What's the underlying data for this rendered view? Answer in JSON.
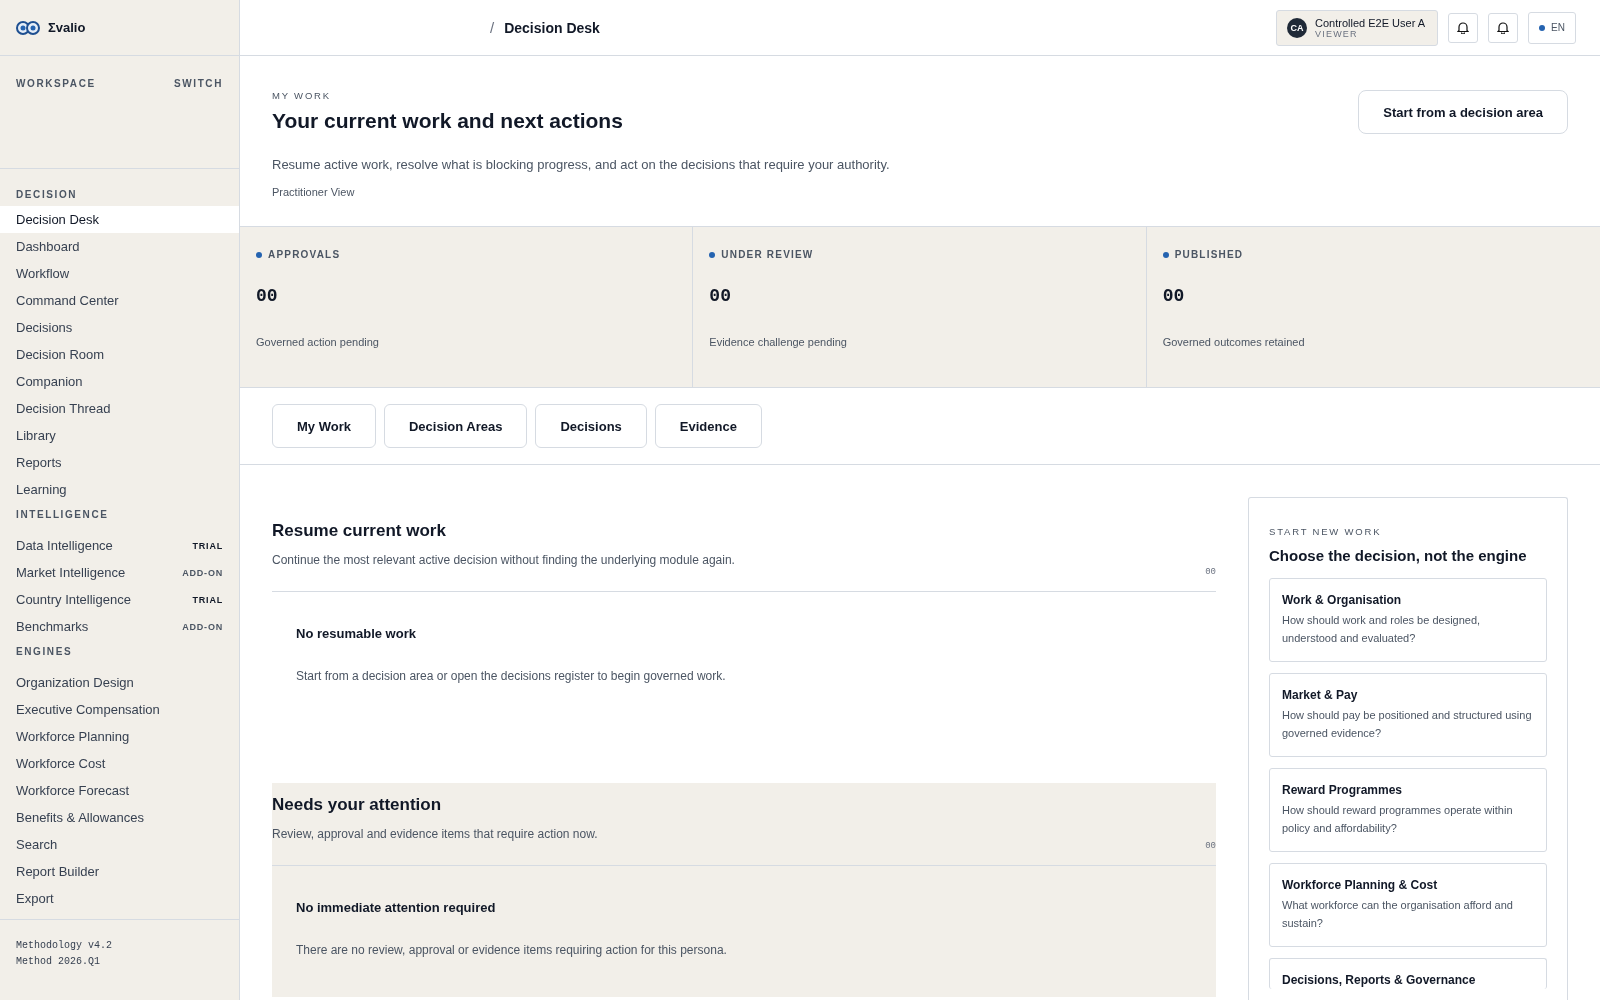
{
  "brand": {
    "name": "Σvalio"
  },
  "breadcrumb": {
    "separator": "/",
    "current": "Decision Desk"
  },
  "user": {
    "initials": "CA",
    "name": "Controlled E2E User A",
    "role": "VIEWER"
  },
  "language": {
    "code": "EN"
  },
  "sidebar": {
    "workspace_label": "WORKSPACE",
    "switch_label": "SWITCH",
    "sections": [
      {
        "title": "DECISION",
        "items": [
          {
            "label": "Decision Desk",
            "selected": true
          },
          {
            "label": "Dashboard",
            "selected": false
          },
          {
            "label": "Workflow",
            "selected": false
          },
          {
            "label": "Command Center",
            "selected": false
          },
          {
            "label": "Decisions",
            "selected": false
          },
          {
            "label": "Decision Room",
            "selected": false
          },
          {
            "label": "Companion",
            "selected": false
          },
          {
            "label": "Decision Thread",
            "selected": false
          },
          {
            "label": "Library",
            "selected": false
          },
          {
            "label": "Reports",
            "selected": false
          },
          {
            "label": "Learning",
            "selected": false
          }
        ]
      },
      {
        "title": "INTELLIGENCE",
        "items": [
          {
            "label": "Data Intelligence",
            "selected": false,
            "badge": {
              "text": "TRIAL",
              "kind": "trial"
            }
          },
          {
            "label": "Market Intelligence",
            "selected": false,
            "badge": {
              "text": "ADD-ON",
              "kind": "addon"
            }
          },
          {
            "label": "Country Intelligence",
            "selected": false,
            "badge": {
              "text": "TRIAL",
              "kind": "trial"
            }
          },
          {
            "label": "Benchmarks",
            "selected": false,
            "badge": {
              "text": "ADD-ON",
              "kind": "addon"
            }
          }
        ]
      },
      {
        "title": "ENGINES",
        "items": [
          {
            "label": "Organization Design",
            "selected": false
          },
          {
            "label": "Executive Compensation",
            "selected": false
          },
          {
            "label": "Workforce Planning",
            "selected": false
          },
          {
            "label": "Workforce Cost",
            "selected": false
          },
          {
            "label": "Workforce Forecast",
            "selected": false
          },
          {
            "label": "Benefits & Allowances",
            "selected": false
          },
          {
            "label": "Search",
            "selected": false
          },
          {
            "label": "Report Builder",
            "selected": false
          },
          {
            "label": "Export",
            "selected": false
          }
        ]
      }
    ],
    "footer": [
      "Methodology v4.2",
      "Method 2026.Q1"
    ]
  },
  "header": {
    "eyebrow": "MY WORK",
    "title": "Your current work and next actions",
    "description": "Resume active work, resolve what is blocking progress, and act on the decisions that require your authority.",
    "view": "Practitioner View",
    "action": "Start from a decision area"
  },
  "stats": [
    {
      "label": "APPROVALS",
      "value": "00",
      "caption": "Governed action pending"
    },
    {
      "label": "UNDER REVIEW",
      "value": "00",
      "caption": "Evidence challenge pending"
    },
    {
      "label": "PUBLISHED",
      "value": "00",
      "caption": "Governed outcomes retained"
    }
  ],
  "tabs": [
    {
      "label": "My Work",
      "selected": false
    },
    {
      "label": "Decision Areas",
      "selected": false
    },
    {
      "label": "Decisions",
      "selected": false
    },
    {
      "label": "Evidence",
      "selected": false
    }
  ],
  "sections": [
    {
      "title": "Resume current work",
      "description": "Continue the most relevant active decision without finding the underlying module again.",
      "count": "00",
      "shaded": false,
      "empty_title": "No resumable work",
      "empty_text": "Start from a decision area or open the decisions register to begin governed work."
    },
    {
      "title": "Needs your attention",
      "description": "Review, approval and evidence items that require action now.",
      "count": "00",
      "shaded": true,
      "empty_title": "No immediate attention required",
      "empty_text": "There are no review, approval or evidence items requiring action for this persona."
    }
  ],
  "start_panel": {
    "eyebrow": "START NEW WORK",
    "title": "Choose the decision, not the engine",
    "cards": [
      {
        "title": "Work & Organisation",
        "description": "How should work and roles be designed, understood and evaluated?"
      },
      {
        "title": "Market & Pay",
        "description": "How should pay be positioned and structured using governed evidence?"
      },
      {
        "title": "Reward Programmes",
        "description": "How should reward programmes operate within policy and affordability?"
      },
      {
        "title": "Workforce Planning & Cost",
        "description": "What workforce can the organisation afford and sustain?"
      },
      {
        "title": "Decisions, Reports & Governance"
      }
    ]
  }
}
